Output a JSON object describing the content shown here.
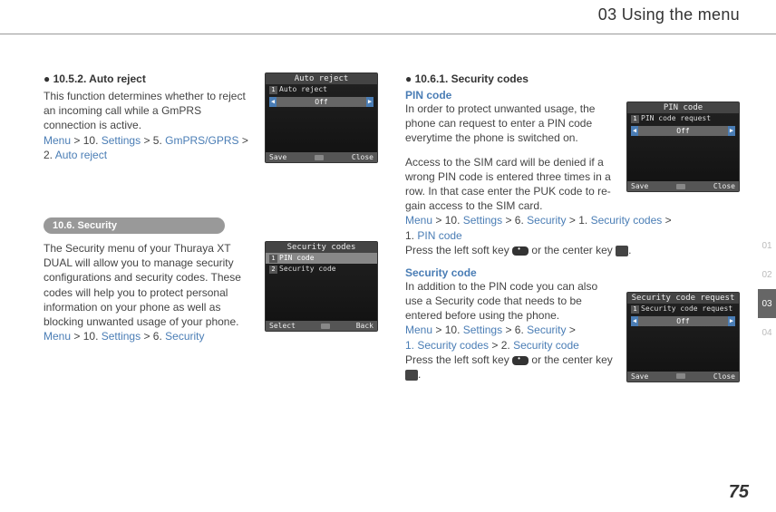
{
  "header": {
    "title": "03 Using the menu"
  },
  "tabs": [
    "01",
    "02",
    "03",
    "04"
  ],
  "active_tab_index": 2,
  "page_number": "75",
  "col1": {
    "h1": "● 10.5.2. Auto reject",
    "p1": "This function determines whether to reject an incoming call while a GmPRS connection is active.",
    "bc1": {
      "a": "Menu",
      "b": "> 10.",
      "c": "Settings",
      "d": "> 5.",
      "e": "GmPRS/GPRS",
      "f": ">",
      "g": "2.",
      "h": "Auto reject"
    },
    "sec_bar": "10.6. Security",
    "p2": "The Security menu of your Thuraya XT DUAL will allow you to manage security configurations and security codes. These codes will help you to protect personal information on your phone as well as blocking unwanted usage of your phone.",
    "bc2": {
      "a": "Menu",
      "b": "> 10.",
      "c": "Settings",
      "d": "> 6.",
      "e": "Security"
    }
  },
  "col2": {
    "h1": "● 10.6.1. Security codes",
    "pin_head": "PIN code",
    "pin_p1": "In order to protect unwanted usage, the phone can request to enter a PIN code everytime the phone is switched on.",
    "pin_p2": "Access to the SIM card will be denied if a wrong PIN code is entered three times in a row. In that case enter the PUK code to re-gain access to the SIM card.",
    "bc1": {
      "a": "Menu",
      "b": "> 10.",
      "c": "Settings",
      "d": "> 6.",
      "e": "Security",
      "f": "> 1.",
      "g": "Security codes",
      "h": ">",
      "i": "1.",
      "j": "PIN code"
    },
    "press1a": "Press the left soft key ",
    "press1b": " or the center key ",
    "press1c": ".",
    "sec_head": "Security code",
    "sec_p": "In addition to the PIN code you can also use a Security code that needs to be entered before using the phone.",
    "bc2": {
      "a": "Menu",
      "b": "> 10.",
      "c": "Settings",
      "d": "> 6.",
      "e": "Security",
      "f": ">",
      "g": "1. Security codes",
      "h": "> 2.",
      "i": "Security code"
    },
    "press2a": "Press the left soft key ",
    "press2b": " or the center key ",
    "press2c": "."
  },
  "phone1": {
    "title": "Auto reject",
    "row": "Auto reject",
    "val": "Off",
    "left": "Save",
    "right": "Close"
  },
  "phone2": {
    "title": "Security codes",
    "r1": "PIN code",
    "r2": "Security code",
    "left": "Select",
    "right": "Back"
  },
  "phone3": {
    "title": "PIN code",
    "row": "PIN code request",
    "val": "Off",
    "left": "Save",
    "right": "Close"
  },
  "phone4": {
    "title": "Security code request",
    "row": "Security code request",
    "val": "Off",
    "left": "Save",
    "right": "Close"
  }
}
